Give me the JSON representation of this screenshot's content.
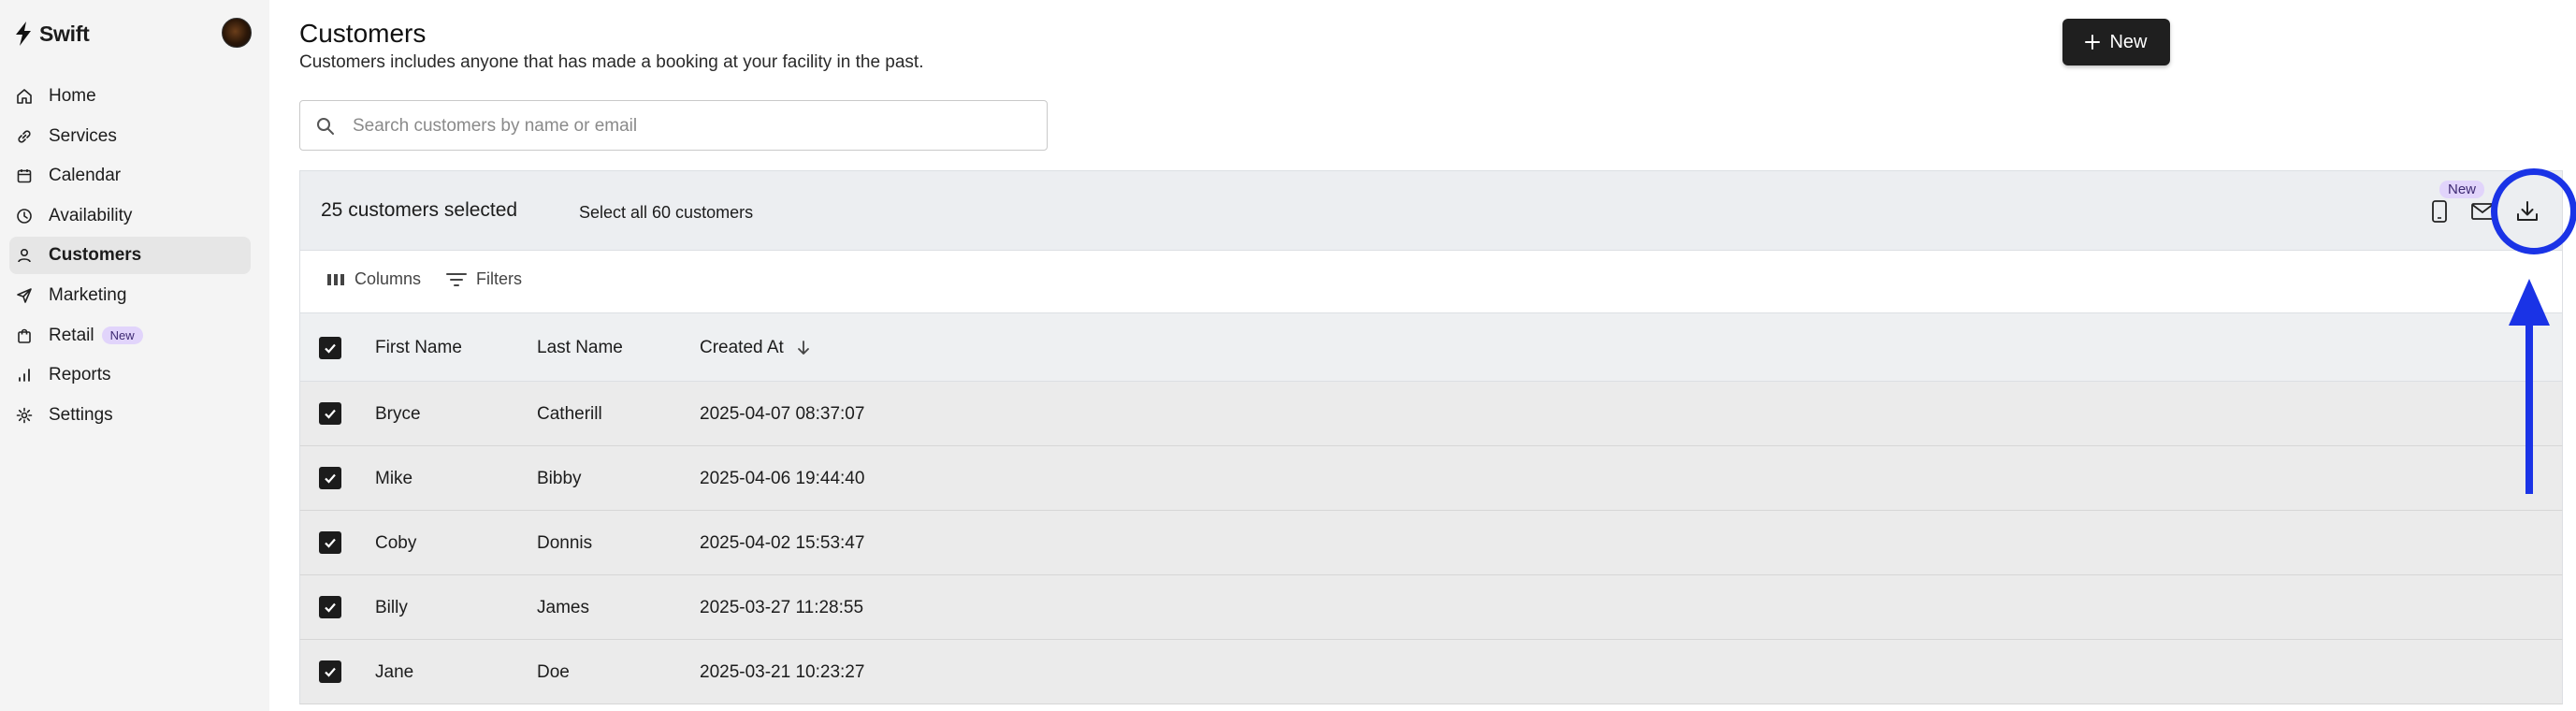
{
  "brand": {
    "name": "Swift"
  },
  "sidebar": {
    "items": [
      {
        "label": "Home",
        "icon": "home-icon",
        "active": false
      },
      {
        "label": "Services",
        "icon": "link-icon",
        "active": false
      },
      {
        "label": "Calendar",
        "icon": "calendar-icon",
        "active": false
      },
      {
        "label": "Availability",
        "icon": "clock-icon",
        "active": false
      },
      {
        "label": "Customers",
        "icon": "user-icon",
        "active": true
      },
      {
        "label": "Marketing",
        "icon": "send-icon",
        "active": false
      },
      {
        "label": "Retail",
        "icon": "shopping-bag-icon",
        "active": false,
        "badge": "New"
      },
      {
        "label": "Reports",
        "icon": "bar-chart-icon",
        "active": false
      },
      {
        "label": "Settings",
        "icon": "gear-icon",
        "active": false
      }
    ]
  },
  "header": {
    "title": "Customers",
    "subtitle": "Customers includes anyone that has made a booking at your facility in the past.",
    "new_button": "New"
  },
  "search": {
    "placeholder": "Search customers by name or email",
    "value": ""
  },
  "selection": {
    "count_label": "25 customers selected",
    "select_all_label": "Select all 60 customers",
    "new_tag": "New",
    "actions": [
      "phone-icon",
      "mail-icon",
      "download-icon"
    ]
  },
  "toolbar": {
    "columns_label": "Columns",
    "filters_label": "Filters"
  },
  "table": {
    "columns": [
      "First Name",
      "Last Name",
      "Created At"
    ],
    "sort": {
      "column": "Created At",
      "direction": "descending"
    },
    "rows": [
      {
        "first": "Bryce",
        "last": "Catherill",
        "created": "2025-04-07 08:37:07",
        "checked": true
      },
      {
        "first": "Mike",
        "last": "Bibby",
        "created": "2025-04-06 19:44:40",
        "checked": true
      },
      {
        "first": "Coby",
        "last": "Donnis",
        "created": "2025-04-02 15:53:47",
        "checked": true
      },
      {
        "first": "Billy",
        "last": "James",
        "created": "2025-03-27 11:28:55",
        "checked": true
      },
      {
        "first": "Jane",
        "last": "Doe",
        "created": "2025-03-21 10:23:27",
        "checked": true
      }
    ]
  },
  "colors": {
    "accent": "#1f1f1f",
    "badge_bg": "#e1d4fb",
    "annotation": "#1a33e6"
  }
}
